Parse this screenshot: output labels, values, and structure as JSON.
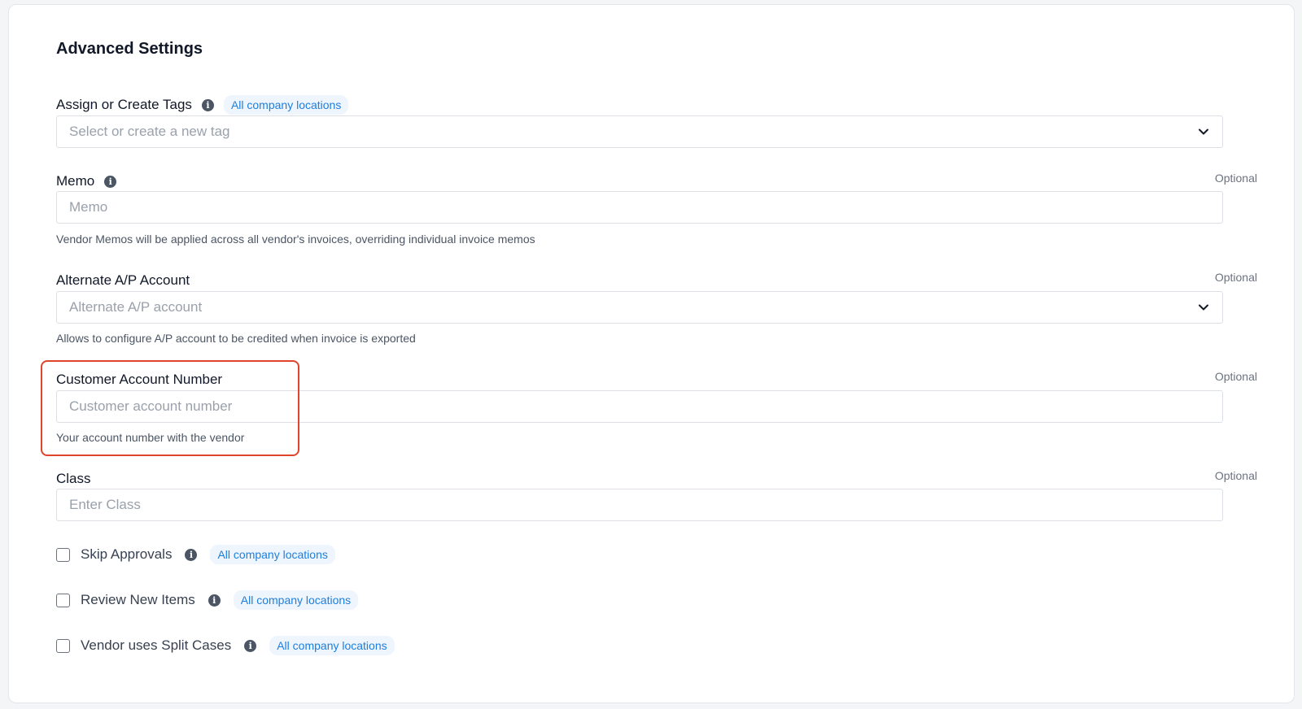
{
  "section": {
    "title": "Advanced Settings"
  },
  "tags": {
    "label": "Assign or Create Tags",
    "chip": "All company locations",
    "placeholder": "Select or create a new tag"
  },
  "memo": {
    "label": "Memo",
    "optional": "Optional",
    "placeholder": "Memo",
    "help": "Vendor Memos will be applied across all vendor's invoices, overriding individual invoice memos"
  },
  "ap_account": {
    "label": "Alternate A/P Account",
    "optional": "Optional",
    "placeholder": "Alternate A/P account",
    "help": "Allows to configure A/P account to be credited when invoice is exported"
  },
  "customer_account": {
    "label": "Customer Account Number",
    "optional": "Optional",
    "placeholder": "Customer account number",
    "help": "Your account number with the vendor",
    "highlighted": true
  },
  "class_field": {
    "label": "Class",
    "optional": "Optional",
    "placeholder": "Enter Class"
  },
  "checkboxes": [
    {
      "label": "Skip Approvals",
      "chip": "All company locations",
      "checked": false
    },
    {
      "label": "Review New Items",
      "chip": "All company locations",
      "checked": false
    },
    {
      "label": "Vendor uses Split Cases",
      "chip": "All company locations",
      "checked": false
    }
  ],
  "colors": {
    "chip_text": "#1d7fe0",
    "chip_bg": "#eef5fd",
    "highlight_border": "#e0442a"
  },
  "icons": {
    "info": "info-circle-icon",
    "dropdown": "chevron-down-icon"
  }
}
